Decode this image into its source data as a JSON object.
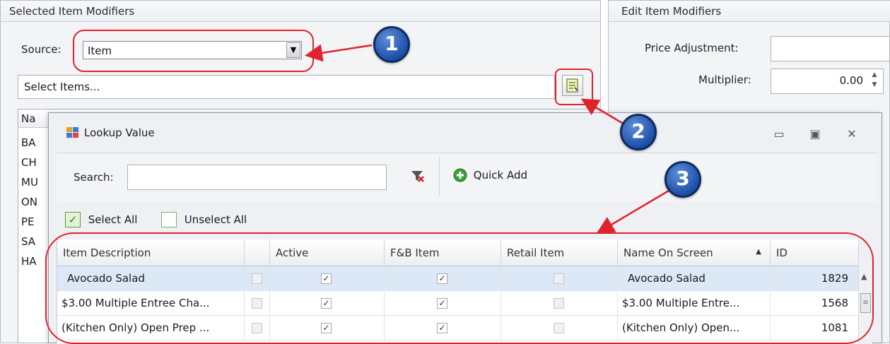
{
  "left_panel": {
    "title": "Selected Item Modifiers",
    "source_label": "Source:",
    "source_value": "Item",
    "select_items_text": "Select Items...",
    "list_header": "Na",
    "list_items": [
      "BA",
      "CH",
      "MU",
      "ON",
      "PE",
      "SA",
      "HA"
    ]
  },
  "right_panel": {
    "title": "Edit Item Modifiers",
    "price_label": "Price Adjustment:",
    "price_value": "",
    "multiplier_label": "Multiplier:",
    "multiplier_value": "0.00"
  },
  "dialog": {
    "title": "Lookup Value",
    "search_label": "Search:",
    "search_value": "",
    "quick_add_label": "Quick Add",
    "select_all_label": "Select All",
    "unselect_all_label": "Unselect All",
    "columns": [
      "Item Description",
      "",
      "Active",
      "F&B Item",
      "Retail Item",
      "Name On Screen",
      "ID"
    ],
    "sort_indicator": "▲",
    "rows": [
      {
        "description": "Avocado Salad",
        "selected": false,
        "active": true,
        "fb_item": true,
        "retail_item": false,
        "name_on_screen": "Avocado Salad",
        "id": "1829"
      },
      {
        "description": "$3.00 Multiple Entree Cha...",
        "selected": false,
        "active": true,
        "fb_item": true,
        "retail_item": false,
        "name_on_screen": "$3.00 Multiple Entre...",
        "id": "1568"
      },
      {
        "description": "(Kitchen Only) Open Prep ...",
        "selected": false,
        "active": true,
        "fb_item": true,
        "retail_item": false,
        "name_on_screen": "(Kitchen Only) Open...",
        "id": "1081"
      }
    ]
  },
  "callouts": [
    "1",
    "2",
    "3"
  ],
  "colors": {
    "callout": "#1d4fa8",
    "highlight": "#e0222d",
    "row_selected": "#dde8f7"
  }
}
